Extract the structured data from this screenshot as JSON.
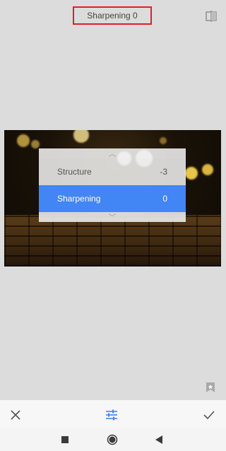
{
  "header": {
    "title": "Sharpening 0"
  },
  "icons": {
    "compare": "compare-icon",
    "bookmark": "bookmark-icon",
    "cancel": "close-icon",
    "tune": "tune-icon",
    "apply": "check-icon",
    "recents": "square-icon",
    "home": "circle-icon",
    "back": "back-triangle-icon"
  },
  "panel": {
    "up_arrow": "︿",
    "down_arrow": "﹀",
    "rows": [
      {
        "label": "Structure",
        "value": "-3"
      },
      {
        "label": "Sharpening",
        "value": "0"
      }
    ]
  },
  "colors": {
    "accent": "#4285f4",
    "highlight_border": "#e02020"
  }
}
